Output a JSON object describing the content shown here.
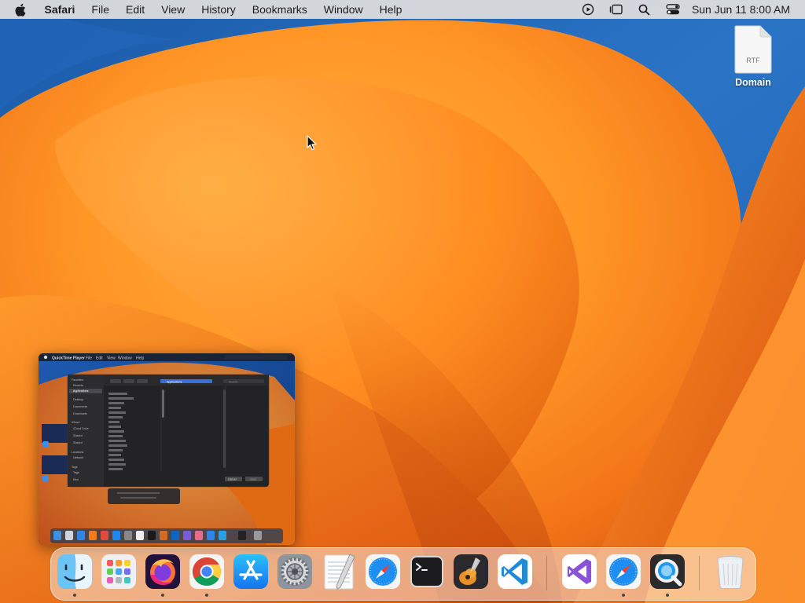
{
  "menubar": {
    "app_name": "Safari",
    "items": [
      "File",
      "Edit",
      "View",
      "History",
      "Bookmarks",
      "Window",
      "Help"
    ],
    "status_icons": [
      "screen-record-icon",
      "stage-manager-icon",
      "spotlight-search-icon",
      "control-center-icon"
    ],
    "clock": "Sun Jun 11  8:00 AM"
  },
  "desktop": {
    "file_icon": {
      "type_label": "RTF",
      "name": "Domain"
    }
  },
  "thumbnail": {
    "title": "Screenshot preview",
    "menu_items": [
      "QuickTime Player",
      "File",
      "Edit",
      "View",
      "Window",
      "Help"
    ],
    "sidebar_items": [
      "Favorites",
      "Recents",
      "Applications",
      "Desktop",
      "Documents",
      "Downloads",
      "iCloud",
      "iCloud Drive",
      "Shared",
      "Locations",
      "Network",
      "Tags",
      "Red"
    ],
    "folder_path": "Applications",
    "search_placeholder": "Search",
    "buttons": [
      "Cancel",
      "Open"
    ]
  },
  "dock": {
    "apps": [
      {
        "name": "Finder",
        "icon": "finder-icon",
        "running": true
      },
      {
        "name": "Launchpad",
        "icon": "launchpad-icon",
        "running": false
      },
      {
        "name": "Firefox",
        "icon": "firefox-icon",
        "running": true
      },
      {
        "name": "Google Chrome",
        "icon": "chrome-icon",
        "running": true
      },
      {
        "name": "App Store",
        "icon": "app-store-icon",
        "running": false
      },
      {
        "name": "System Settings",
        "icon": "system-settings-icon",
        "running": false
      },
      {
        "name": "TextEdit",
        "icon": "textedit-icon",
        "running": false
      },
      {
        "name": "Safari",
        "icon": "safari-icon",
        "running": false
      },
      {
        "name": "Terminal",
        "icon": "terminal-icon",
        "running": false
      },
      {
        "name": "GarageBand",
        "icon": "garageband-icon",
        "running": false
      },
      {
        "name": "Visual Studio Code",
        "icon": "vscode-icon",
        "running": false
      },
      {
        "name": "Visual Studio",
        "icon": "visual-studio-icon",
        "running": false
      },
      {
        "name": "Safari",
        "icon": "safari-icon",
        "running": true
      },
      {
        "name": "QuickTime Player",
        "icon": "quicktime-icon",
        "running": true
      },
      {
        "name": "Trash",
        "icon": "trash-icon",
        "running": false
      }
    ]
  }
}
